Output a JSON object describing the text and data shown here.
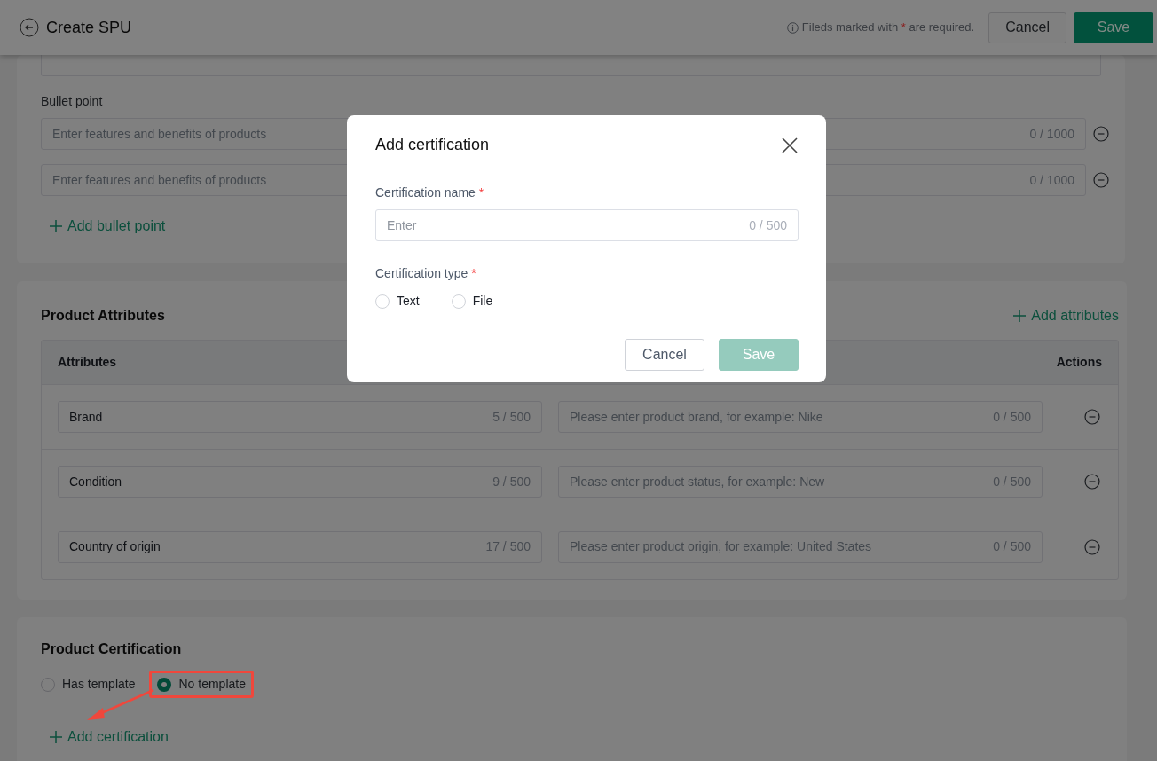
{
  "header": {
    "title": "Create SPU",
    "note": {
      "before": "Fileds marked with ",
      "mark": "*",
      "after": " are required."
    },
    "buttons": [
      {
        "label": "Cancel",
        "kind": "secondary"
      },
      {
        "label": "Save",
        "kind": "primary"
      }
    ]
  },
  "bullet_points": {
    "label": "Bullet point",
    "items": [
      {
        "placeholder": "Enter features and benefits of products",
        "counter": "0 / 1000"
      },
      {
        "placeholder": "Enter features and benefits of products",
        "counter": "0 / 1000"
      }
    ],
    "add_label": "Add bullet point"
  },
  "attributes": {
    "title": "Product Attributes",
    "add_label": "Add attributes",
    "columns": [
      "Attributes",
      "Actions"
    ],
    "rows": [
      {
        "name": "Brand",
        "name_counter": "5 / 500",
        "value_placeholder": "Please enter product brand, for example: Nike",
        "value_counter": "0 / 500"
      },
      {
        "name": "Condition",
        "name_counter": "9 / 500",
        "value_placeholder": "Please enter product status, for example: New",
        "value_counter": "0 / 500"
      },
      {
        "name": "Country of origin",
        "name_counter": "17 / 500",
        "value_placeholder": "Please enter product origin, for example: United States",
        "value_counter": "0 / 500"
      }
    ]
  },
  "certification": {
    "title": "Product Certification",
    "options": [
      {
        "label": "Has template",
        "selected": false,
        "highlighted": false
      },
      {
        "label": "No template",
        "selected": true,
        "highlighted": true
      }
    ],
    "add_label": "Add certification"
  },
  "modal": {
    "title": "Add certification",
    "fields": [
      {
        "kind": "text",
        "label": "Certification name",
        "required_mark": "*",
        "placeholder": "Enter",
        "counter": "0 / 500"
      },
      {
        "kind": "radio",
        "label": "Certification type",
        "required_mark": "*",
        "options": [
          {
            "label": "Text",
            "selected": false
          },
          {
            "label": "File",
            "selected": false
          }
        ]
      }
    ],
    "buttons": [
      {
        "label": "Cancel",
        "kind": "secondary",
        "disabled": false
      },
      {
        "label": "Save",
        "kind": "primary",
        "disabled": true
      }
    ]
  }
}
